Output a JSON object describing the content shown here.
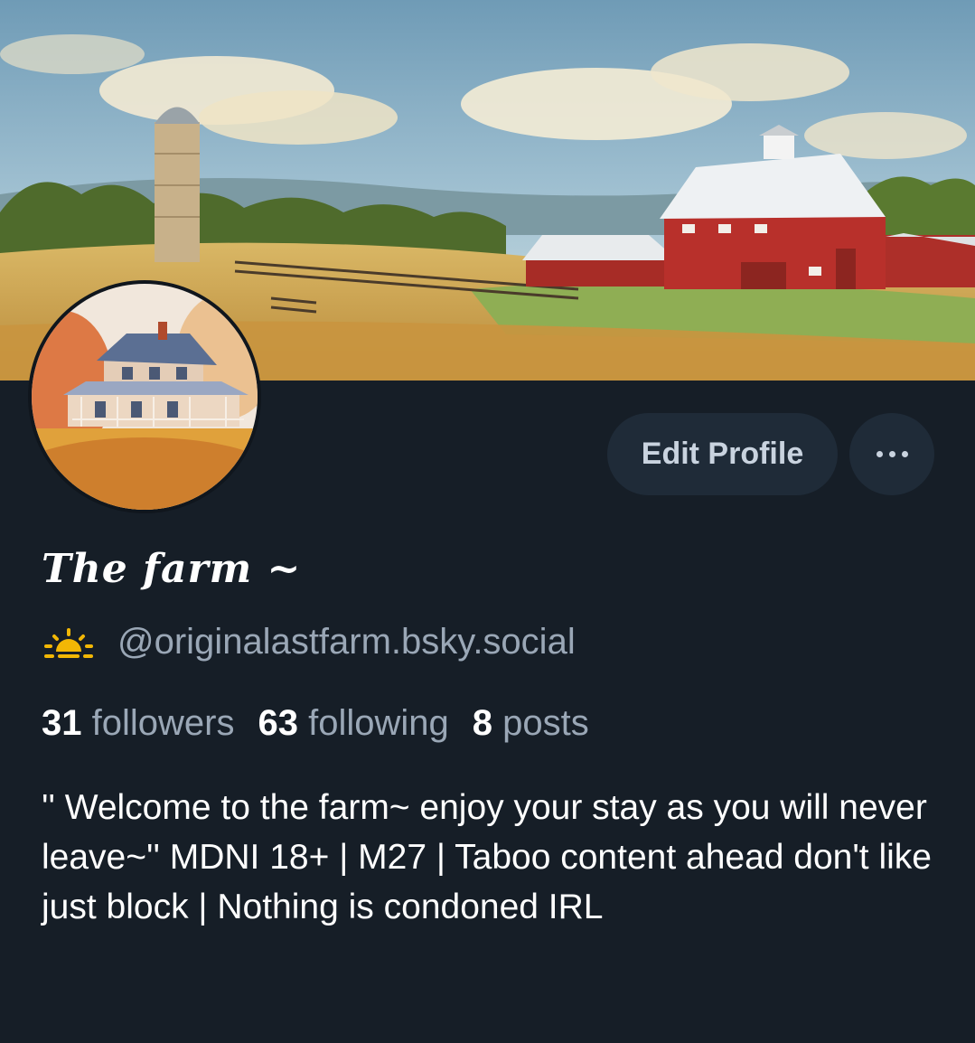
{
  "profile": {
    "display_name": "The farm ~",
    "handle": "@originalastfarm.bsky.social",
    "handle_emoji": "sunrise-icon",
    "bio": "'' Welcome to the farm~ enjoy your stay as you will never leave~'' MDNI 18+ | M27 | Taboo content ahead don't like just block | Nothing is condoned IRL"
  },
  "stats": {
    "followers_count": "31",
    "followers_label": "followers",
    "following_count": "63",
    "following_label": "following",
    "posts_count": "8",
    "posts_label": "posts"
  },
  "actions": {
    "edit_label": "Edit Profile",
    "more_icon": "ellipsis-icon"
  },
  "banner": {
    "description_icon": "farm-landscape-banner"
  },
  "avatar": {
    "description_icon": "farmhouse-avatar"
  },
  "colors": {
    "background": "#161e27",
    "button_bg": "#1f2b38",
    "muted_text": "#9aa7b6",
    "barn_red": "#b8302b",
    "emoji_yellow": "#f2b705"
  }
}
